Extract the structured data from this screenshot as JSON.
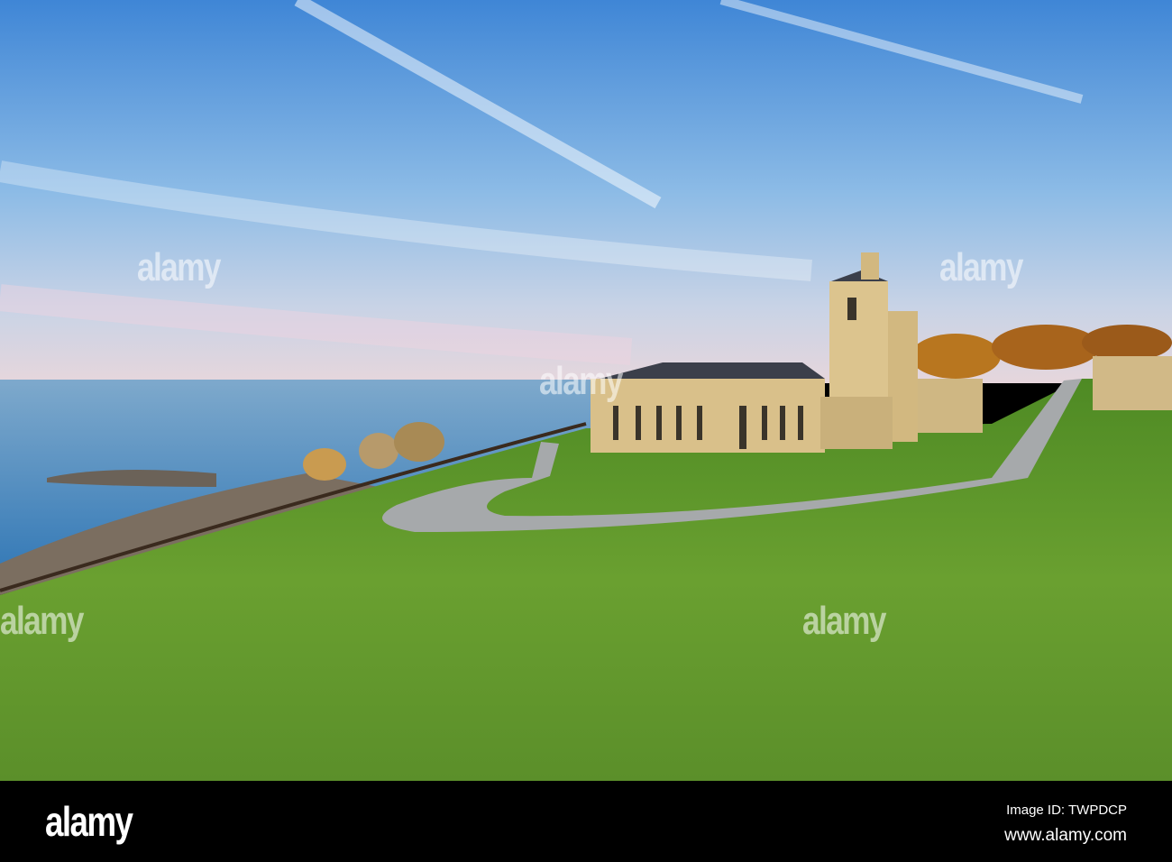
{
  "watermark": {
    "text": "alamy"
  },
  "footer": {
    "logo": "alamy",
    "image_id": "Image ID: TWPDCP",
    "website": "www.alamy.com"
  },
  "colors": {
    "sky_top": "#3f86d6",
    "sky_bottom": "#e8d6dc",
    "lake": "#4f8fc4",
    "grass": "#5f9a2e",
    "building": "#d9c08a",
    "road": "#a6a9ab"
  }
}
